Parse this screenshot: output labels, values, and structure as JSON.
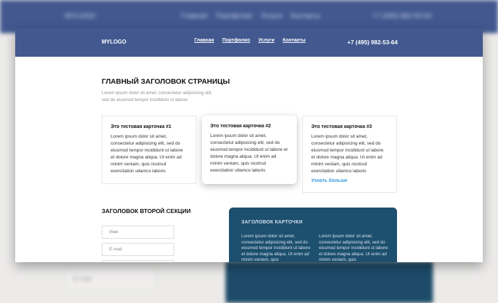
{
  "header": {
    "logo": "MYLOGO",
    "nav": [
      "Главная",
      "Портфолио",
      "Услуги",
      "Контакты"
    ],
    "phone": "+7 (495) 982-53-64"
  },
  "hero": {
    "title": "ГЛАВНЫЙ ЗАГОЛОВОК СТРАНИЦЫ",
    "subtitle": "Lorem ipsum dolor sit amet, consectetur adipisicing elit, sed do eiusmod tempor incididunt ut labore"
  },
  "cards": [
    {
      "title": "Это тестовая карточка #1",
      "body": "Lorem ipsum dolor sit amet, consectetur adipisicing elit, sed do eiusmod tempor incididunt ut labore et dolore magna aliqua. Ut enim ad minim veniam, quis nostrud exercitation ullamco laboris"
    },
    {
      "title": "Это тестовая карточка #2",
      "body": "Lorem ipsum dolor sit amet, consectetur adipisicing elit, sed do eiusmod tempor incididunt ut labore et dolore magna aliqua. Ut enim ad minim veniam, quis nostrud exercitation ullamco laboris"
    },
    {
      "title": "Это тестовая карточка #3",
      "body": "Lorem ipsum dolor sit amet, consectetur adipisicing elit, sed do eiusmod tempor incididunt ut labore et dolore magna aliqua. Ut enim ad minim veniam, quis nostrud exercitation ullamco laboris",
      "link": "Узнать больше"
    }
  ],
  "section2": {
    "title": "ЗАГОЛОВОК ВТОРОЙ СЕКЦИИ",
    "name_placeholder": "Имя",
    "email_placeholder": "E-mail"
  },
  "info_card": {
    "title": "ЗАГОЛОВОК КАРТОЧКИ",
    "col1": "Lorem ipsum dolor sit amet, consectetur adipisicing elit, sed do eiusmod tempor incididunt ut labore et dolore magna aliqua. Ut enim ad minim veniam, quis",
    "col2": "Lorem ipsum dolor sit amet, consectetur adipisicing elit, sed do eiusmod tempor incididunt ut labore et dolore magna aliqua. Ut enim ad minim veniam, quis"
  }
}
